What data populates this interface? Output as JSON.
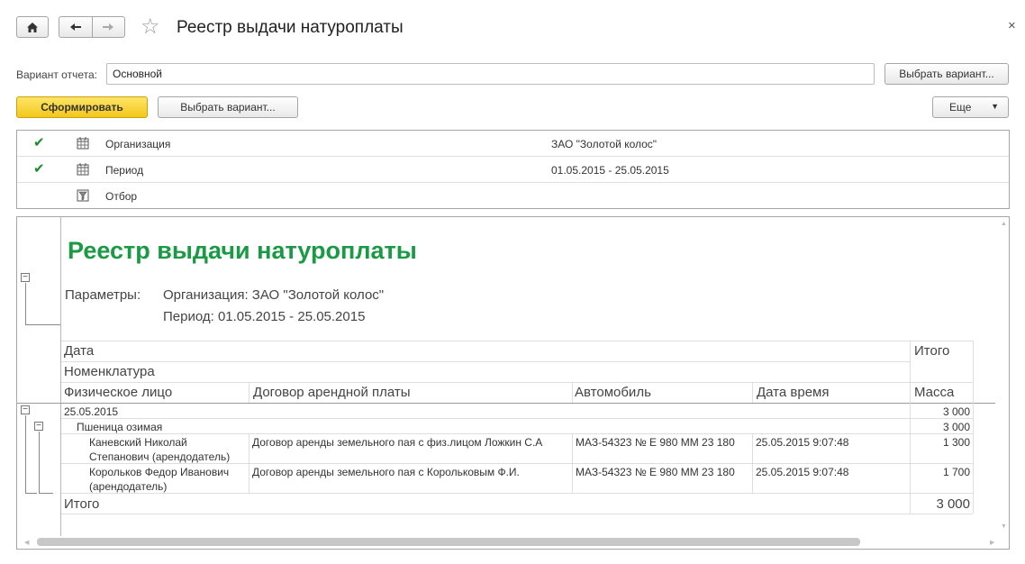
{
  "window": {
    "title": "Реестр выдачи натуроплаты",
    "close_glyph": "×"
  },
  "variant": {
    "label": "Вариант отчета:",
    "value": "Основной",
    "choose_label": "Выбрать вариант..."
  },
  "toolbar": {
    "generate_label": "Сформировать",
    "choose_variant_label": "Выбрать вариант...",
    "more_label": "Еще"
  },
  "settings": [
    {
      "checked": true,
      "name": "Организация",
      "value": "ЗАО \"Золотой колос\"",
      "icon": "calendar-table-icon"
    },
    {
      "checked": true,
      "name": "Период",
      "value": "01.05.2015 - 25.05.2015",
      "icon": "calendar-table-icon"
    },
    {
      "checked": false,
      "name": "Отбор",
      "value": "",
      "icon": "filter-icon"
    }
  ],
  "report": {
    "title": "Реестр выдачи натуроплаты",
    "params_label": "Параметры:",
    "param_org": "Организация: ЗАО \"Золотой колос\"",
    "param_period": "Период: 01.05.2015 - 25.05.2015",
    "headers": {
      "date": "Дата",
      "nomenclature": "Номенклатура",
      "person": "Физическое лицо",
      "contract": "Договор арендной платы",
      "car": "Автомобиль",
      "datetime": "Дата время",
      "total": "Итого",
      "mass": "Масса"
    },
    "group_date": {
      "label": "25.05.2015",
      "value": "3 000"
    },
    "group_item": {
      "label": "Пшеница озимая",
      "value": "3 000"
    },
    "rows": [
      {
        "person_line1": "Каневский Николай",
        "person_line2": "Степанович (арендодатель)",
        "contract": "Договор аренды земельного пая с физ.лицом Ложкин С.А",
        "car": "МАЗ-54323 № Е 980 ММ 23 180",
        "datetime": "25.05.2015 9:07:48",
        "mass": "1 300"
      },
      {
        "person_line1": "Корольков Федор Иванович",
        "person_line2": "(арендодатель)",
        "contract": "Договор аренды земельного пая с Корольковым Ф.И.",
        "car": "МАЗ-54323 № Е 980 ММ 23 180",
        "datetime": "25.05.2015 9:07:48",
        "mass": "1 700"
      }
    ],
    "total_label": "Итого",
    "total_value": "3 000"
  },
  "colors": {
    "accent_green": "#1a9a44",
    "primary_button": "#f3c81c",
    "check_green": "#1b8a2f"
  }
}
